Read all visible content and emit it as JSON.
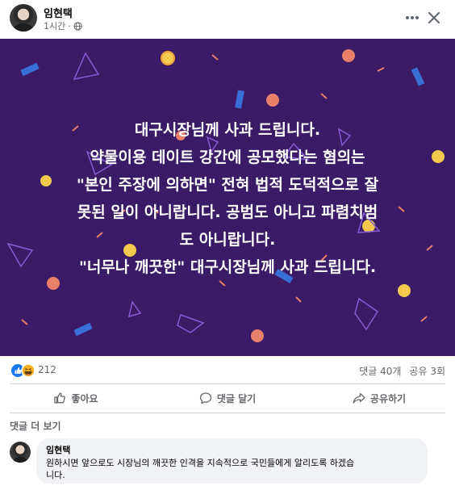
{
  "post": {
    "author": "임현택",
    "time": "1시간",
    "privacy_icon": "globe-icon"
  },
  "header": {
    "more_icon": "more-horizontal-icon",
    "close_icon": "close-icon"
  },
  "banner": {
    "background": "#3b1a66",
    "lines": [
      "대구시장님께 사과 드립니다.",
      "약물이용 데이트 강간에 공모했다는 혐의는",
      "\"본인 주장에 의하면\" 전혀 법적 도덕적으로 잘",
      "못된 일이 아니랍니다. 공범도 아니고 파렴치범",
      "도 아니랍니다.",
      "\"너무나 깨끗한\" 대구시장님께 사과 드립니다."
    ]
  },
  "reactions": {
    "count": "212",
    "icons": [
      "like-icon",
      "haha-icon"
    ],
    "comments": "댓글 40개",
    "shares": "공유 3회"
  },
  "actions": {
    "like": "좋아요",
    "comment": "댓글 달기",
    "share": "공유하기"
  },
  "comments": {
    "more_label": "댓글 더 보기",
    "items": [
      {
        "author": "임현택",
        "text_line1": "원하시면 앞으로도 시장님의 깨끗한 인격을 지속적으로 국민들에게 알리도록 하겠습",
        "text_line2": "니다."
      }
    ]
  },
  "colors": {
    "accent": "#1877f2",
    "secondary_text": "#65676b",
    "bubble": "#f0f2f5"
  }
}
